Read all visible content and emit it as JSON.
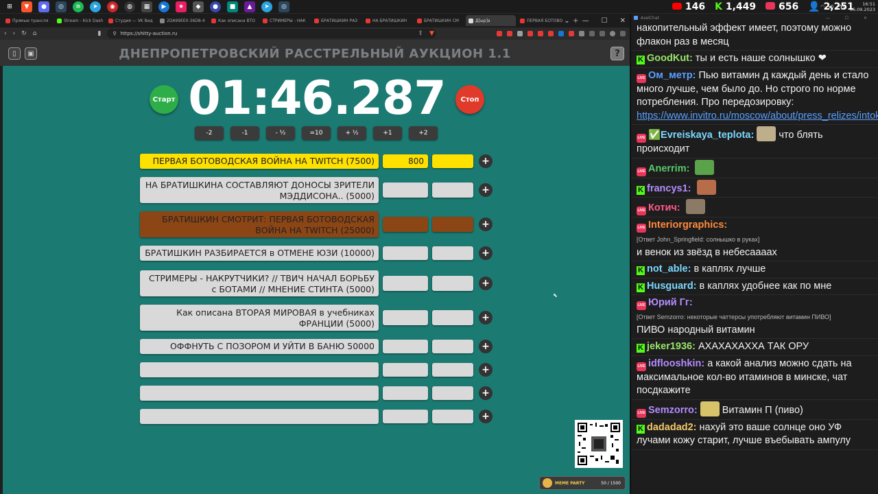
{
  "taskbar": {
    "tray_lang": "РУС",
    "time": "16:51",
    "date": "06.09.2023"
  },
  "browser": {
    "tabs": [
      {
        "label": "Прямые трансля",
        "color": "#e53935"
      },
      {
        "label": "Stream - Kick Dash",
        "color": "#53fc18"
      },
      {
        "label": "Студия — VK Вид",
        "color": "#e53935"
      },
      {
        "label": "2DA99EE0-36D8-4",
        "color": "#888888"
      },
      {
        "label": "Как описана ВТО",
        "color": "#e53935"
      },
      {
        "label": "СТРИМЕРЫ - НАК",
        "color": "#e53935"
      },
      {
        "label": "БРАТИШКИН РАЗ",
        "color": "#e53935"
      },
      {
        "label": "НА БРАТИШКИН",
        "color": "#e53935"
      },
      {
        "label": "БРАТИШКИН СМ",
        "color": "#e53935"
      },
      {
        "label": "Д[ыр]а",
        "color": "#dddddd",
        "active": true
      },
      {
        "label": "ПЕРВАЯ БОТОВО",
        "color": "#e53935"
      }
    ],
    "url": "https://shitty-auction.ru"
  },
  "app": {
    "title": "ДНЕПРОПЕТРОВСКИЙ РАССТРЕЛЬНЫЙ АУКЦИОН 1.1",
    "help_label": "?",
    "start_label": "Старт",
    "stop_label": "Стоп",
    "timer": "01:46.287",
    "adjust_buttons": [
      "-2",
      "-1",
      "- ½",
      "=10",
      "+ ½",
      "+1",
      "+2"
    ],
    "lots": [
      {
        "name": "ПЕРВАЯ БОТОВОДСКАЯ ВОЙНА НА TWITCH (7500)",
        "amount": "800",
        "color": "#ffe100"
      },
      {
        "name": "НА БРАТИШКИНА СОСТАВЛЯЮТ ДОНОСЫ ЗРИТЕЛИ МЭДДИСОНА.. (5000)",
        "amount": "",
        "color": "#d9d9d9"
      },
      {
        "name": "БРАТИШКИН СМОТРИТ: ПЕРВАЯ БОТОВОДСКАЯ ВОЙНА НА TWITCH (25000)",
        "amount": "",
        "color": "#8c4515"
      },
      {
        "name": "БРАТИШКИН РАЗБИРАЕТСЯ в ОТМЕНЕ ЮЗИ (10000)",
        "amount": "",
        "color": "#d9d9d9"
      },
      {
        "name": "СТРИМЕРЫ - НАКРУТЧИКИ? // ТВИЧ НАЧАЛ БОРЬБУ с БОТАМИ // МНЕНИЕ СТИНТА (5000)",
        "amount": "",
        "color": "#d9d9d9"
      },
      {
        "name": "Как описана ВТОРАЯ МИРОВАЯ в учебниках ФРАНЦИИ (5000)",
        "amount": "",
        "color": "#d9d9d9"
      },
      {
        "name": "ОФФНУТЬ С ПОЗОРОМ И УЙТИ В БАНЮ 50000",
        "amount": "",
        "color": "#d9d9d9"
      },
      {
        "name": "",
        "amount": "",
        "color": "#d9d9d9"
      },
      {
        "name": "",
        "amount": "",
        "color": "#d9d9d9"
      },
      {
        "name": "",
        "amount": "",
        "color": "#d9d9d9"
      }
    ],
    "meme_label": "MEME PARTY",
    "meme_counter": "50 / 1500"
  },
  "chat": {
    "app_name": "AxelChat",
    "stats": {
      "youtube": "146",
      "kick": "1,449",
      "live": "656",
      "viewers": "2,251"
    },
    "messages": [
      {
        "badge": "",
        "user": "",
        "user_color": "#ffffff",
        "text": "накопительный эффект имеет, поэтому можно флакон раз в месяц",
        "reply": "",
        "link": ""
      },
      {
        "badge": "kick",
        "user": "GoodKut:",
        "user_color": "#9be36b",
        "text": "ты и есть наше солнышко ❤",
        "reply": "",
        "link": ""
      },
      {
        "badge": "live",
        "user": "Ом_метр:",
        "user_color": "#5aa0ff",
        "text": "Пью витамин д каждый день и стало много лучше, чем было до. Но строго по норме потребления. Про передозировку:",
        "reply": "",
        "link": "https://www.invitro.ru/moscow/about/press_relizes/intoksikat..."
      },
      {
        "badge": "live",
        "user": "✅Evreiskaya_teplota:",
        "user_color": "#7cd8ff",
        "text": "что блять происходит",
        "reply": "",
        "link": ""
      },
      {
        "badge": "live",
        "user": "Anerrim:",
        "user_color": "#59c96a",
        "text": "",
        "reply": "",
        "link": ""
      },
      {
        "badge": "kick",
        "user": "francys1:",
        "user_color": "#b48cff",
        "text": "",
        "reply": "",
        "link": ""
      },
      {
        "badge": "live",
        "user": "Котич:",
        "user_color": "#ff5a8a",
        "text": "",
        "reply": "",
        "link": ""
      },
      {
        "badge": "live",
        "user": "Interiorgraphics:",
        "user_color": "#ff8a3d",
        "text": "и венок из звёзд в небесаааах",
        "reply": "[Ответ John_Springfield: солнышко в руках]",
        "link": ""
      },
      {
        "badge": "kick",
        "user": "not_able:",
        "user_color": "#7cd8ff",
        "text": "в каплях лучше",
        "reply": "",
        "link": ""
      },
      {
        "badge": "kick",
        "user": "Husguard:",
        "user_color": "#7cd8ff",
        "text": "в каплях удобнее как по мне",
        "reply": "",
        "link": ""
      },
      {
        "badge": "live",
        "user": "Юрий Гг:",
        "user_color": "#b48cff",
        "text": "ПИВО народный витамин",
        "reply": "[Ответ Semzorro: некоторые чаттерсы употребляют витамин ПИВО]",
        "link": ""
      },
      {
        "badge": "kick",
        "user": "jeker1936:",
        "user_color": "#9be36b",
        "text": "АХАХАХАХХА ТАК ОРУ",
        "reply": "",
        "link": ""
      },
      {
        "badge": "live",
        "user": "idflooshkin:",
        "user_color": "#b48cff",
        "text": "а какой анализ можно сдать на максимальное кол-во итаминов в минске, чат посдкажите",
        "reply": "",
        "link": ""
      },
      {
        "badge": "live",
        "user": "Semzorro:",
        "user_color": "#b48cff",
        "text": "Витамин П (пиво)",
        "reply": "",
        "link": ""
      },
      {
        "badge": "kick",
        "user": "dadadad2:",
        "user_color": "#f2c96b",
        "text": "нахуй это ваше солнце оно УФ лучами кожу старит, лучше въебывать ампулу",
        "reply": "",
        "link": ""
      }
    ]
  }
}
